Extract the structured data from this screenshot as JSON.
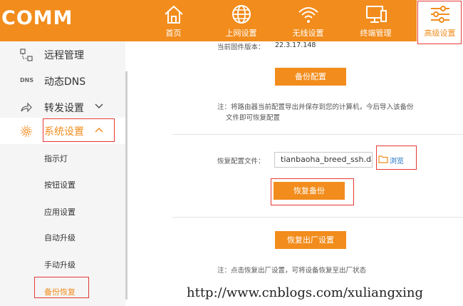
{
  "brand": "COMM",
  "nav": [
    {
      "label": "首页",
      "icon": "home-icon"
    },
    {
      "label": "上网设置",
      "icon": "globe-icon"
    },
    {
      "label": "无线设置",
      "icon": "wifi-icon"
    },
    {
      "label": "终端管理",
      "icon": "devices-icon"
    },
    {
      "label": "高级设置",
      "icon": "sliders-icon"
    }
  ],
  "sidebar": {
    "items": [
      {
        "label": "远程管理",
        "icon": "remote-icon"
      },
      {
        "label": "动态DNS",
        "icon": "dns-icon",
        "icon_text": "DNS"
      },
      {
        "label": "转发设置",
        "icon": "forward-icon"
      },
      {
        "label": "系统设置",
        "icon": "gear-icon"
      }
    ],
    "subitems": [
      "指示灯",
      "按钮设置",
      "应用设置",
      "自动升级",
      "手动升级",
      "备份恢复"
    ]
  },
  "main": {
    "firmware_label": "当前固件版本：",
    "firmware_version": "22.3.17.148",
    "backup_button": "备份配置",
    "backup_note_line1": "注：将路由器当前配置导出并保存到您的计算机，今后导入该备份",
    "backup_note_line2": "文件即可恢复配置",
    "restore_label": "恢复配置文件：",
    "restore_file": "tianbaoha_breed_ssh.dat",
    "browse_label": "浏览",
    "restore_button": "恢复备份",
    "factory_button": "恢复出厂设置",
    "factory_note": "注：点击恢复出厂设置，可将设备恢复至出厂状态"
  },
  "watermark": "http://www.cnblogs.com/xuliangxing",
  "colors": {
    "accent": "#f28c1c",
    "highlight": "#e53935",
    "sidebar_bg": "#f5f5f5"
  }
}
